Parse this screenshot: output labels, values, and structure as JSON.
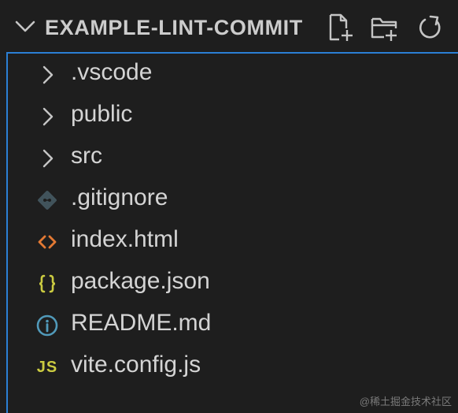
{
  "explorer": {
    "title": "EXAMPLE-LINT-COMMIT",
    "collapse_icon": "chevron-down-icon",
    "actions": [
      {
        "name": "new-file",
        "icon": "new-file-icon"
      },
      {
        "name": "new-folder",
        "icon": "new-folder-icon"
      },
      {
        "name": "refresh",
        "icon": "refresh-icon"
      }
    ],
    "items": [
      {
        "label": ".vscode",
        "type": "folder",
        "icon": "chevron-right-icon"
      },
      {
        "label": "public",
        "type": "folder",
        "icon": "chevron-right-icon"
      },
      {
        "label": "src",
        "type": "folder",
        "icon": "chevron-right-icon"
      },
      {
        "label": ".gitignore",
        "type": "file",
        "icon": "git-icon"
      },
      {
        "label": "index.html",
        "type": "file",
        "icon": "html-icon"
      },
      {
        "label": "package.json",
        "type": "file",
        "icon": "json-icon"
      },
      {
        "label": "README.md",
        "type": "file",
        "icon": "info-icon"
      },
      {
        "label": "vite.config.js",
        "type": "file",
        "icon": "js-icon",
        "icon_text": "JS"
      }
    ]
  },
  "watermark": "@稀土掘金技术社区",
  "colors": {
    "background": "#1e1e1e",
    "focus_border": "#2b7fd4",
    "git": "#41535b",
    "html": "#e37933",
    "json": "#cbcb41",
    "info": "#519aba",
    "js": "#cbcb41"
  }
}
